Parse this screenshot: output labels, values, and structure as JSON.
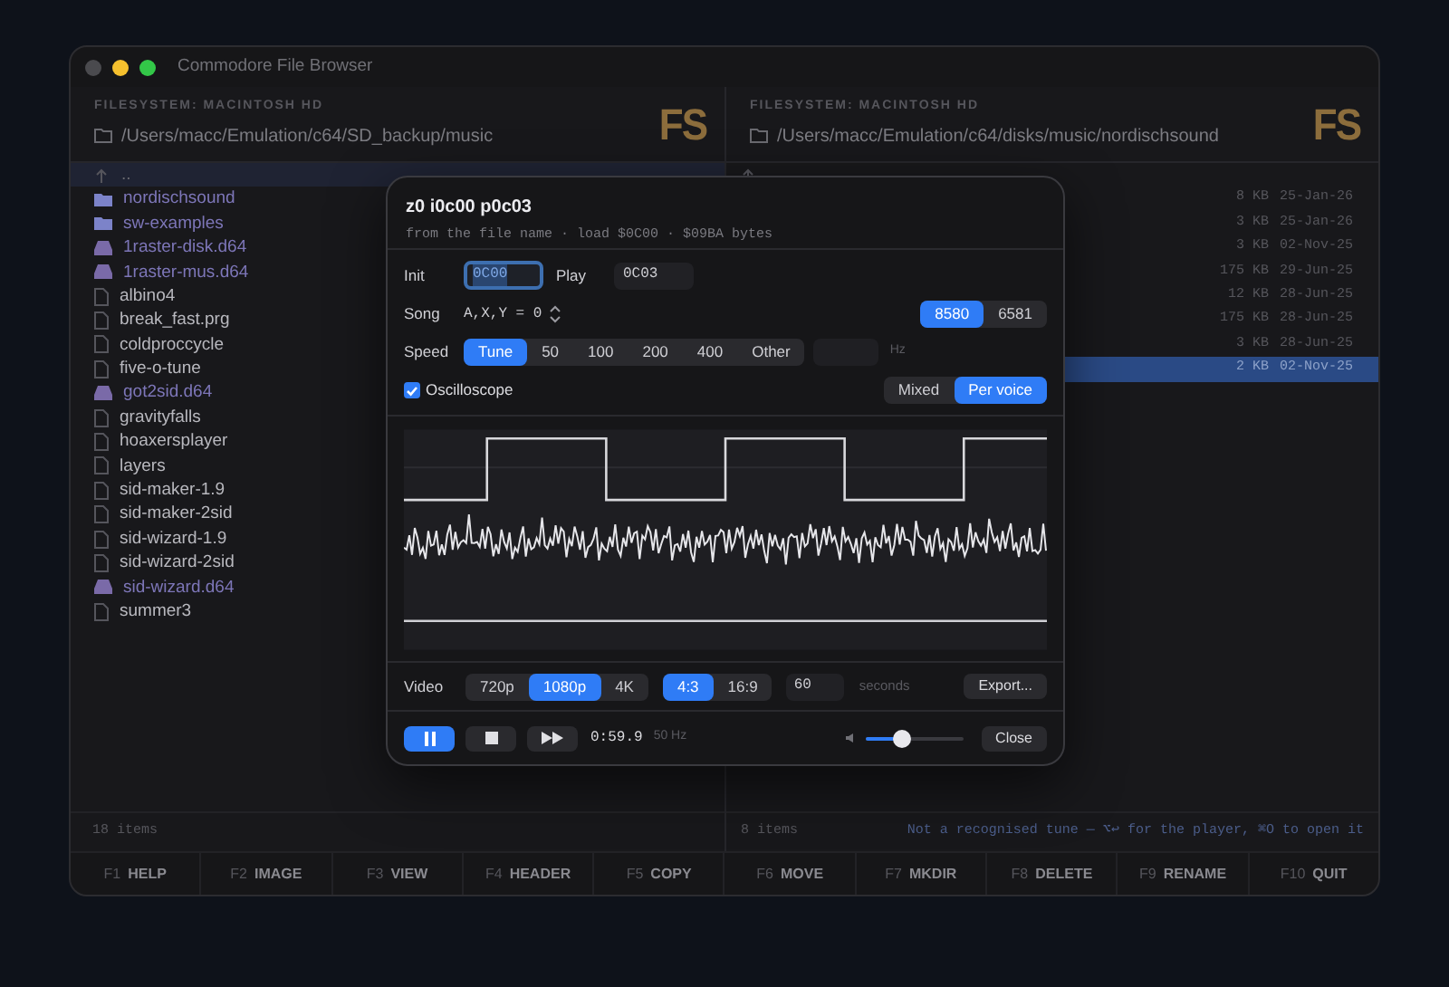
{
  "window": {
    "title": "Commodore File Browser"
  },
  "left_pane": {
    "filesystem": "FILESYSTEM: MACINTOSH HD",
    "path": "/Users/macc/Emulation/c64/SD_backup/music",
    "logo": "FS",
    "parent": {
      "label": "..",
      "selected": true
    },
    "items": [
      {
        "name": "nordischsound",
        "kind": "folder",
        "selected": false
      },
      {
        "name": "sw-examples",
        "kind": "folder",
        "selected": false
      },
      {
        "name": "1raster-disk.d64",
        "kind": "disk",
        "selected": false
      },
      {
        "name": "1raster-mus.d64",
        "kind": "disk",
        "selected": false
      },
      {
        "name": "albino4",
        "kind": "file",
        "selected": false
      },
      {
        "name": "break_fast.prg",
        "kind": "file",
        "selected": false
      },
      {
        "name": "coldproccycle",
        "kind": "file",
        "selected": false
      },
      {
        "name": "five-o-tune",
        "kind": "file",
        "selected": false
      },
      {
        "name": "got2sid.d64",
        "kind": "disk",
        "selected": false
      },
      {
        "name": "gravityfalls",
        "kind": "file",
        "selected": false
      },
      {
        "name": "hoaxersplayer",
        "kind": "file",
        "selected": false
      },
      {
        "name": "layers",
        "kind": "file",
        "selected": false
      },
      {
        "name": "sid-maker-1.9",
        "kind": "file",
        "selected": false
      },
      {
        "name": "sid-maker-2sid",
        "kind": "file",
        "selected": false
      },
      {
        "name": "sid-wizard-1.9",
        "kind": "file",
        "selected": false
      },
      {
        "name": "sid-wizard-2sid",
        "kind": "file",
        "selected": false
      },
      {
        "name": "sid-wizard.d64",
        "kind": "disk",
        "selected": false
      },
      {
        "name": "summer3",
        "kind": "file",
        "selected": false
      }
    ],
    "status": "18 items"
  },
  "right_pane": {
    "filesystem": "FILESYSTEM: MACINTOSH HD",
    "path": "/Users/macc/Emulation/c64/disks/music/nordischsound",
    "logo": "FS",
    "items": [
      {
        "size": "8 KB",
        "date": "25-Jan-26",
        "selected": false
      },
      {
        "size": "3 KB",
        "date": "25-Jan-26",
        "selected": false
      },
      {
        "size": "3 KB",
        "date": "02-Nov-25",
        "selected": false
      },
      {
        "size": "175 KB",
        "date": "29-Jun-25",
        "selected": false
      },
      {
        "size": "12 KB",
        "date": "28-Jun-25",
        "selected": false
      },
      {
        "size": "175 KB",
        "date": "28-Jun-25",
        "selected": false
      },
      {
        "size": "3 KB",
        "date": "28-Jun-25",
        "selected": false
      },
      {
        "size": "2 KB",
        "date": "02-Nov-25",
        "selected": true
      }
    ],
    "status": "8 items",
    "message": "Not a recognised tune — ⌥↩ for the player, ⌘O to open it"
  },
  "dialog": {
    "title": "z0 i0c00 p0c03",
    "subtitle": "from the file name · load $0C00 · $09BA bytes",
    "init": {
      "label": "Init",
      "value": "0C00"
    },
    "play": {
      "label": "Play",
      "value": "0C03"
    },
    "song": {
      "label": "Song",
      "value": "A,X,Y = 0"
    },
    "chips": [
      {
        "label": "8580",
        "selected": true
      },
      {
        "label": "6581",
        "selected": false
      }
    ],
    "speed": {
      "label": "Speed",
      "options": [
        {
          "label": "Tune",
          "selected": true
        },
        {
          "label": "50",
          "selected": false
        },
        {
          "label": "100",
          "selected": false
        },
        {
          "label": "200",
          "selected": false
        },
        {
          "label": "400",
          "selected": false
        },
        {
          "label": "Other",
          "selected": false
        }
      ],
      "unit": "Hz"
    },
    "oscilloscope": {
      "label": "Oscilloscope",
      "checked": true
    },
    "modes": [
      {
        "label": "Mixed",
        "selected": false
      },
      {
        "label": "Per voice",
        "selected": true
      }
    ],
    "video": {
      "label": "Video",
      "resolutions": [
        {
          "label": "720p",
          "selected": false
        },
        {
          "label": "1080p",
          "selected": true
        },
        {
          "label": "4K",
          "selected": false
        }
      ],
      "aspects": [
        {
          "label": "4:3",
          "selected": true
        },
        {
          "label": "16:9",
          "selected": false
        }
      ],
      "duration": "60",
      "unit": "seconds",
      "export": "Export..."
    },
    "transport": {
      "buttons": [
        {
          "kind": "pause",
          "selected": true
        },
        {
          "kind": "stop",
          "selected": false
        },
        {
          "kind": "forward",
          "selected": false
        }
      ],
      "time": "0:59.9",
      "rate": "50 Hz",
      "volume": {
        "level": 0.38
      },
      "close": "Close"
    }
  },
  "function_keys": [
    {
      "key": "F1",
      "label": "HELP"
    },
    {
      "key": "F2",
      "label": "IMAGE"
    },
    {
      "key": "F3",
      "label": "VIEW"
    },
    {
      "key": "F4",
      "label": "HEADER"
    },
    {
      "key": "F5",
      "label": "COPY"
    },
    {
      "key": "F6",
      "label": "MOVE"
    },
    {
      "key": "F7",
      "label": "MKDIR"
    },
    {
      "key": "F8",
      "label": "DELETE"
    },
    {
      "key": "F9",
      "label": "RENAME"
    },
    {
      "key": "F10",
      "label": "QUIT"
    }
  ]
}
